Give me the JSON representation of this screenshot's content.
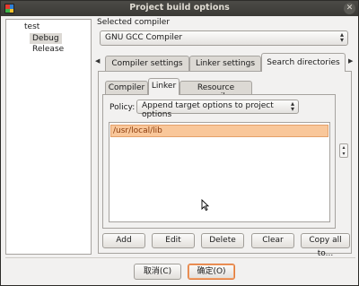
{
  "window": {
    "title": "Project build options"
  },
  "tree": {
    "root": "test",
    "items": [
      "Debug",
      "Release"
    ]
  },
  "compiler": {
    "label": "Selected compiler",
    "value": "GNU GCC Compiler"
  },
  "top_tabs": [
    {
      "label": "Compiler settings"
    },
    {
      "label": "Linker settings"
    },
    {
      "label": "Search directories"
    }
  ],
  "sub_tabs": [
    {
      "label": "Compiler"
    },
    {
      "label": "Linker"
    },
    {
      "label": "Resource compiler"
    }
  ],
  "policy": {
    "label": "Policy:",
    "value": "Append target options to project options"
  },
  "directories": [
    "/usr/local/lib"
  ],
  "actions": [
    "Add",
    "Edit",
    "Delete",
    "Clear",
    "Copy all to..."
  ],
  "footer": {
    "cancel": "取消(C)",
    "ok": "确定(O)"
  },
  "colors": {
    "accent": "#f9c79a",
    "titlebar": "#3c3b37"
  }
}
